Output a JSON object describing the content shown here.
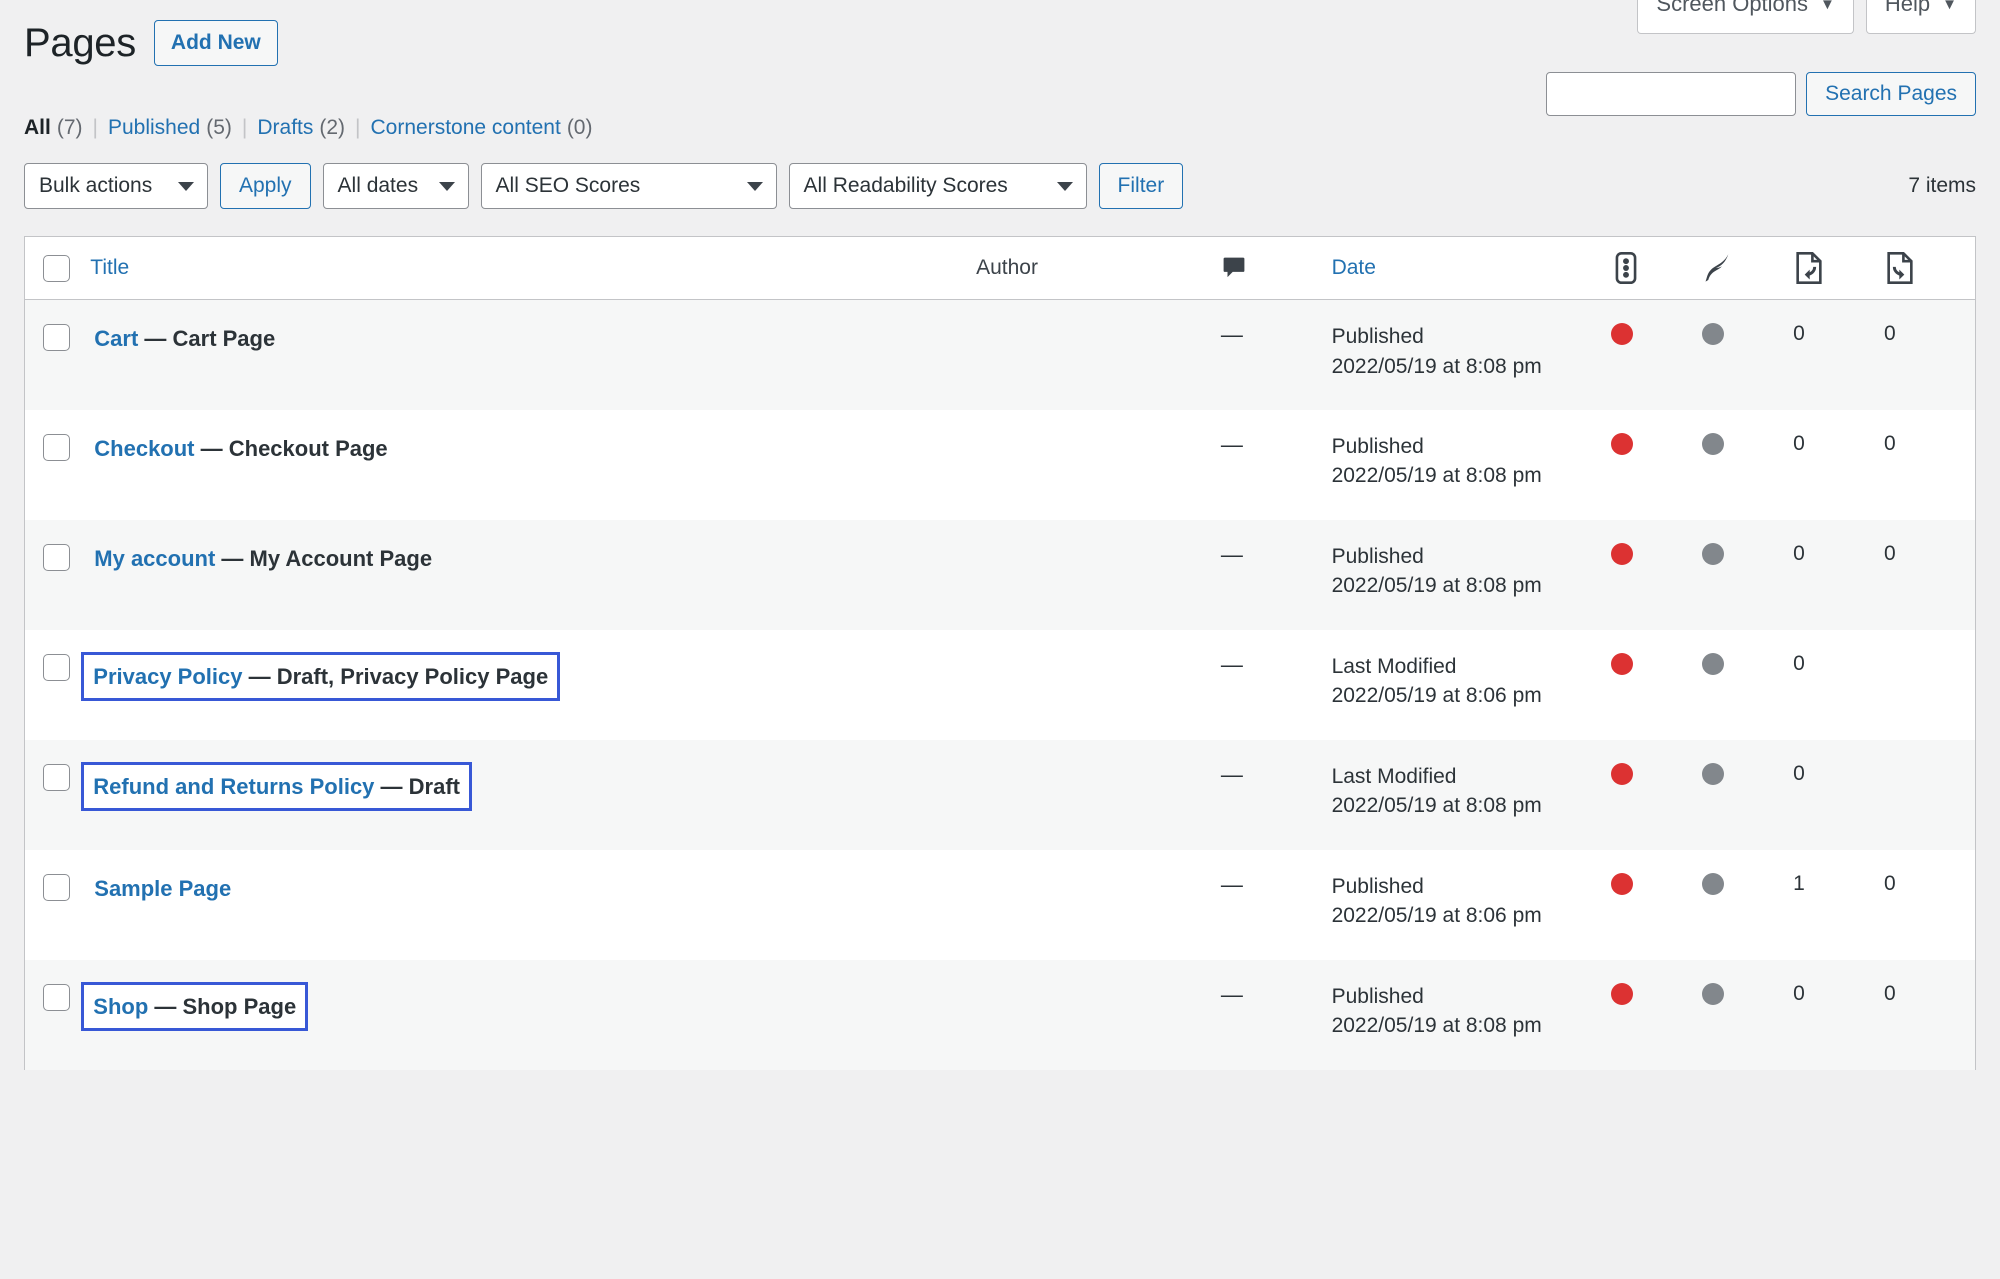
{
  "meta_buttons": [
    {
      "label": "Screen Options",
      "name": "screen-options-button"
    },
    {
      "label": "Help",
      "name": "help-button"
    }
  ],
  "header": {
    "title": "Pages",
    "add_new_label": "Add New"
  },
  "search": {
    "value": "",
    "placeholder": "",
    "button_label": "Search Pages"
  },
  "status_links": [
    {
      "label": "All",
      "count": "(7)",
      "current": true
    },
    {
      "label": "Published",
      "count": "(5)",
      "current": false
    },
    {
      "label": "Drafts",
      "count": "(2)",
      "current": false
    },
    {
      "label": "Cornerstone content",
      "count": "(0)",
      "current": false
    }
  ],
  "separator": "|",
  "tablenav": {
    "bulk_actions": "Bulk actions",
    "apply_label": "Apply",
    "all_dates": "All dates",
    "all_seo_scores": "All SEO Scores",
    "all_readability_scores": "All Readability Scores",
    "filter_label": "Filter",
    "items_count": "7 items"
  },
  "table": {
    "headers": {
      "title": "Title",
      "author": "Author",
      "comments_icon": "comment-bubble-icon",
      "date": "Date",
      "seo_icon": "seo-traffic-light-icon",
      "readability_icon": "readability-feather-icon",
      "inbound_links_icon": "incoming-links-icon",
      "outbound_links_icon": "outgoing-links-icon"
    },
    "rows": [
      {
        "title": "Cart",
        "suffix": " — Cart Page",
        "highlighted": false,
        "author": "",
        "comments": "—",
        "date_status": "Published",
        "date_value": "2022/05/19 at 8:08 pm",
        "seo_score": "red",
        "readability_score": "grey",
        "inbound_links": "0",
        "outbound_links": "0"
      },
      {
        "title": "Checkout",
        "suffix": " — Checkout Page",
        "highlighted": false,
        "author": "",
        "comments": "—",
        "date_status": "Published",
        "date_value": "2022/05/19 at 8:08 pm",
        "seo_score": "red",
        "readability_score": "grey",
        "inbound_links": "0",
        "outbound_links": "0"
      },
      {
        "title": "My account",
        "suffix": " — My Account Page",
        "highlighted": false,
        "author": "",
        "comments": "—",
        "date_status": "Published",
        "date_value": "2022/05/19 at 8:08 pm",
        "seo_score": "red",
        "readability_score": "grey",
        "inbound_links": "0",
        "outbound_links": "0"
      },
      {
        "title": "Privacy Policy",
        "suffix": " — Draft, Privacy Policy Page",
        "highlighted": true,
        "author": "",
        "comments": "—",
        "date_status": "Last Modified",
        "date_value": "2022/05/19 at 8:06 pm",
        "seo_score": "red",
        "readability_score": "grey",
        "inbound_links": "0",
        "outbound_links": ""
      },
      {
        "title": "Refund and Returns Policy",
        "suffix": " — Draft",
        "highlighted": true,
        "author": "",
        "comments": "—",
        "date_status": "Last Modified",
        "date_value": "2022/05/19 at 8:08 pm",
        "seo_score": "red",
        "readability_score": "grey",
        "inbound_links": "0",
        "outbound_links": ""
      },
      {
        "title": "Sample Page",
        "suffix": "",
        "highlighted": false,
        "author": "",
        "comments": "—",
        "date_status": "Published",
        "date_value": "2022/05/19 at 8:06 pm",
        "seo_score": "red",
        "readability_score": "grey",
        "inbound_links": "1",
        "outbound_links": "0"
      },
      {
        "title": "Shop",
        "suffix": " — Shop Page",
        "highlighted": true,
        "author": "",
        "comments": "—",
        "date_status": "Published",
        "date_value": "2022/05/19 at 8:08 pm",
        "seo_score": "red",
        "readability_score": "grey",
        "inbound_links": "0",
        "outbound_links": "0"
      }
    ]
  },
  "colors": {
    "link": "#2271b1",
    "highlight_border": "#3858d6",
    "seo_red": "#dc3232",
    "readability_grey": "#82878c",
    "page_bg": "#f0f0f1",
    "row_alt_bg": "#f6f7f7"
  }
}
